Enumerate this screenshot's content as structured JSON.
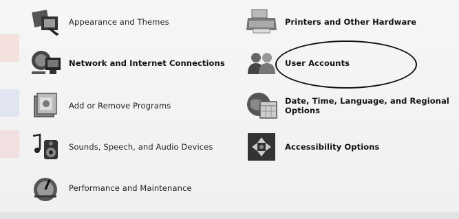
{
  "control_panel": {
    "categories": [
      {
        "label": "Appearance and Themes",
        "icon": "appearance-themes-icon"
      },
      {
        "label": "Printers and Other Hardware",
        "icon": "printer-icon"
      },
      {
        "label": "Network and Internet Connections",
        "icon": "network-icon"
      },
      {
        "label": "User Accounts",
        "icon": "user-accounts-icon"
      },
      {
        "label": "Add or Remove Programs",
        "icon": "add-remove-programs-icon"
      },
      {
        "label": "Date, Time, Language, and Regional Options",
        "icon": "globe-calendar-icon"
      },
      {
        "label": "Sounds, Speech, and Audio Devices",
        "icon": "speaker-music-icon"
      },
      {
        "label": "Accessibility Options",
        "icon": "accessibility-icon"
      },
      {
        "label": "Performance and Maintenance",
        "icon": "performance-gauge-icon"
      }
    ]
  }
}
